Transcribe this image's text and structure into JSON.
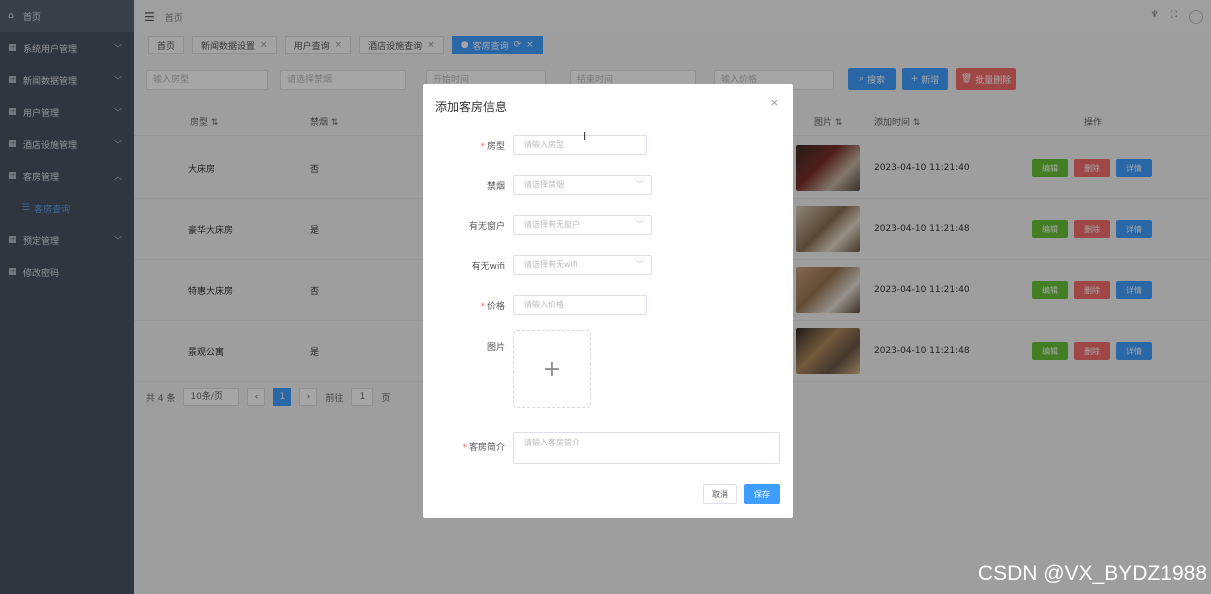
{
  "sidebar": {
    "items": [
      {
        "label": "首页",
        "icon": "home-icon"
      },
      {
        "label": "系统用户管理",
        "icon": "grid-icon"
      },
      {
        "label": "新闻数据管理",
        "icon": "grid-icon"
      },
      {
        "label": "用户管理",
        "icon": "grid-icon"
      },
      {
        "label": "酒店设施管理",
        "icon": "grid-icon"
      },
      {
        "label": "客房管理",
        "icon": "grid-icon"
      },
      {
        "label": "客房查询",
        "icon": "list-icon"
      },
      {
        "label": "预定管理",
        "icon": "grid-icon"
      },
      {
        "label": "修改密码",
        "icon": "grid-icon"
      }
    ]
  },
  "header": {
    "crumb": "首页"
  },
  "tabs": [
    {
      "label": "首页"
    },
    {
      "label": "新闻数据设置"
    },
    {
      "label": "用户查询"
    },
    {
      "label": "酒店设施查询"
    },
    {
      "label": "客房查询"
    }
  ],
  "search": {
    "room_type": "输入房型",
    "smoking": "请选择禁烟",
    "date_start": "开始时间",
    "date_end": "结束时间",
    "price": "输入价格",
    "search_btn": "搜索",
    "add_btn": "新增",
    "batch_delete_btn": "批量删除"
  },
  "table": {
    "headers": {
      "type": "房型",
      "smoking": "禁烟",
      "image": "图片",
      "time": "添加时间",
      "action": "操作"
    },
    "rows": [
      {
        "type": "大床房",
        "smoking": "否",
        "time": "2023-04-10 11:21:40"
      },
      {
        "type": "豪华大床房",
        "smoking": "是",
        "time": "2023-04-10 11:21:48"
      },
      {
        "type": "特惠大床房",
        "smoking": "否",
        "time": "2023-04-10 11:21:40"
      },
      {
        "type": "景观公寓",
        "smoking": "是",
        "time": "2023-04-10 11:21:48"
      }
    ],
    "edit_label": "编辑",
    "delete_label": "删除",
    "detail_label": "详情"
  },
  "pager": {
    "total": "共 4 条",
    "size": "10条/页",
    "page": "1",
    "goto": "前往",
    "goto_value": "1",
    "page_suffix": "页"
  },
  "modal": {
    "title": "添加客房信息",
    "close": "×",
    "fields": {
      "room_type": {
        "label": "房型",
        "placeholder": "请输入房型"
      },
      "smoking": {
        "label": "禁烟",
        "placeholder": "请选择禁烟"
      },
      "window": {
        "label": "有无窗户",
        "placeholder": "请选择有无窗户"
      },
      "wifi": {
        "label": "有无wifi",
        "placeholder": "请选择有无wifi"
      },
      "price": {
        "label": "价格",
        "placeholder": "请输入价格"
      },
      "image": {
        "label": "图片"
      },
      "intro": {
        "label": "客房简介",
        "placeholder": "请输入客房简介"
      }
    },
    "cancel": "取消",
    "save": "保存"
  },
  "watermark": "CSDN @VX_BYDZ1988",
  "colors": {
    "primary": "#409eff",
    "success": "#67c23a",
    "danger": "#f56c6c",
    "sidebar": "#4a5362"
  }
}
